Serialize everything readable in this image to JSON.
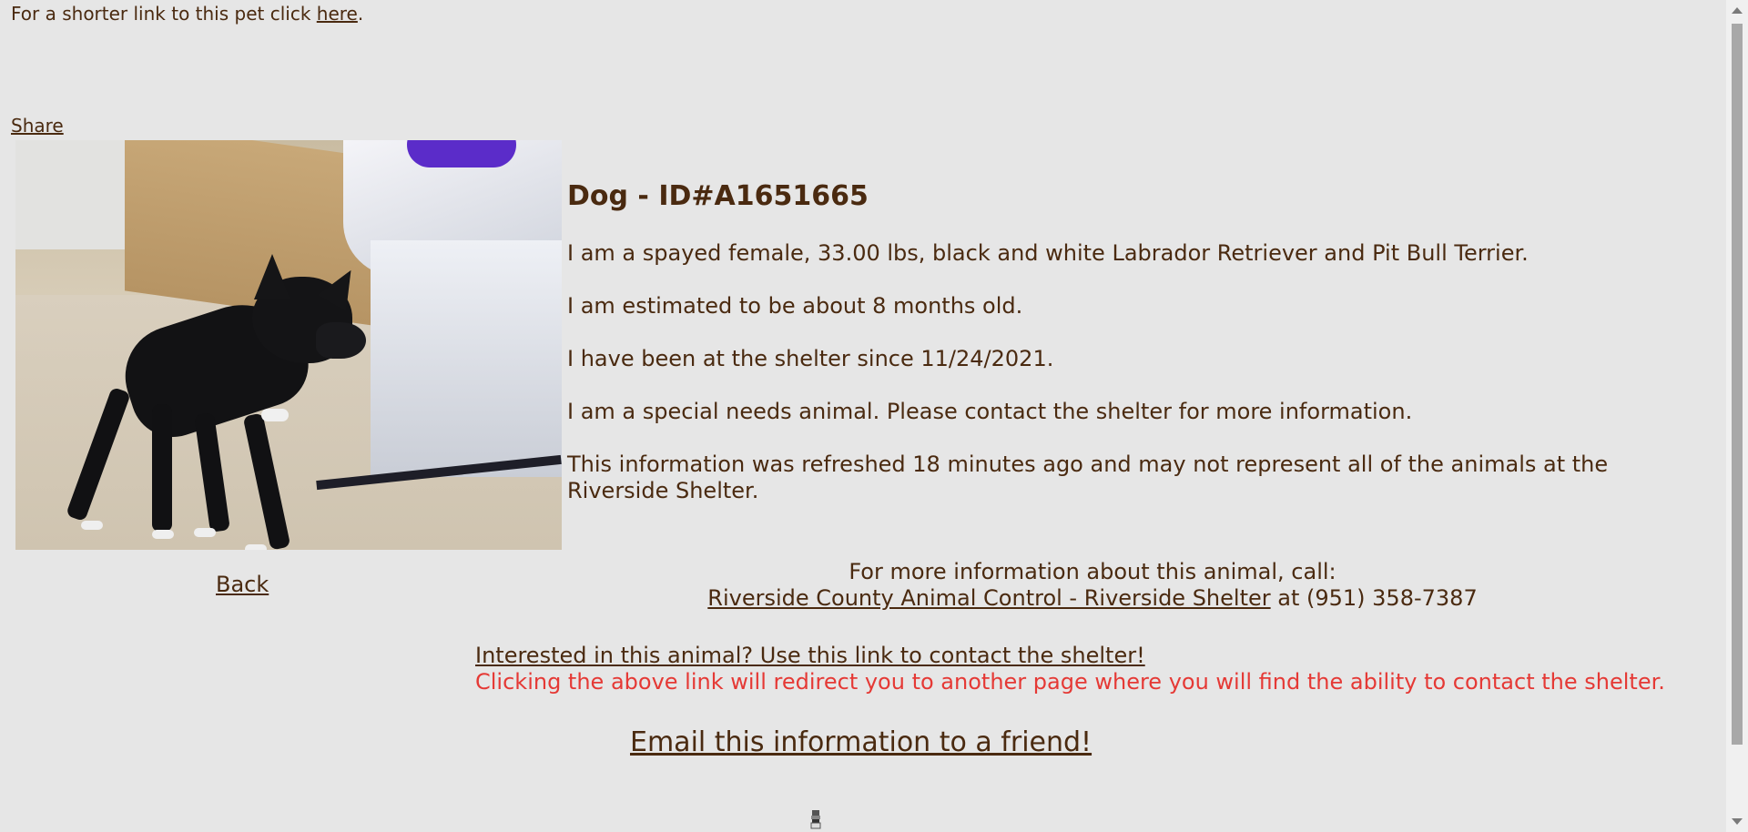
{
  "top": {
    "short_link_prefix": "For a shorter link to this pet click ",
    "short_link_label": "here",
    "short_link_suffix": "."
  },
  "share_label": "Share",
  "animal": {
    "title": "Dog - ID#A1651665",
    "description": "I am a spayed female, 33.00 lbs, black and white Labrador Retriever and Pit Bull Terrier.",
    "age": "I am estimated to be about 8 months old.",
    "since": "I have been at the shelter since 11/24/2021.",
    "special_needs": "I am a special needs animal. Please contact the shelter for more information.",
    "refresh_note": "This information was refreshed 18 minutes ago and may not represent all of the animals at the Riverside Shelter."
  },
  "back_label": "Back",
  "call": {
    "line1": "For more information about this animal, call:",
    "shelter_link": "Riverside County Animal Control - Riverside Shelter",
    "phone_text": " at (951) 358-7387"
  },
  "contact": {
    "link_label": "Interested in this animal? Use this link to contact the shelter!",
    "warning": "Clicking the above link will redirect you to another page where you will find the ability to contact the shelter."
  },
  "email_label": "Email this information to a friend!",
  "icons": {
    "scroll_up": "chevron-up-icon",
    "scroll_down": "chevron-down-icon",
    "bottom": "lighthouse-icon"
  },
  "colors": {
    "text": "#4a2a10",
    "warning": "#e53935",
    "background": "#e6e6e6"
  }
}
